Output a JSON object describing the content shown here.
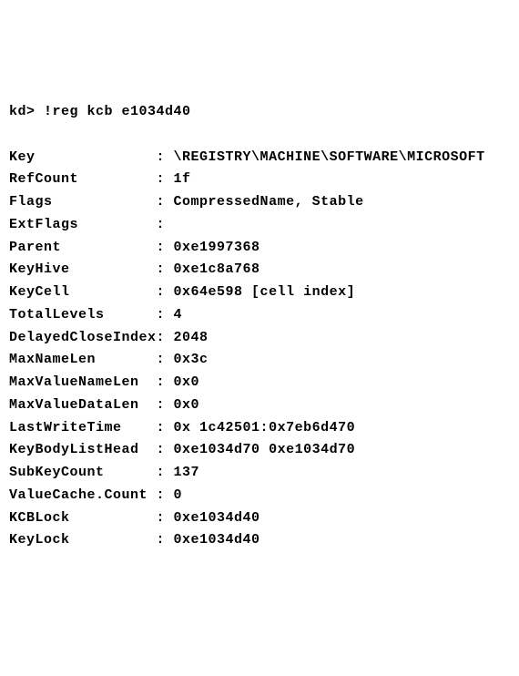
{
  "prompt": "kd> !reg kcb e1034d40",
  "rows": [
    {
      "label": "Key              ",
      "value": "\\REGISTRY\\MACHINE\\SOFTWARE\\MICROSOFT"
    },
    {
      "label": "RefCount         ",
      "value": "1f"
    },
    {
      "label": "Flags            ",
      "value": "CompressedName, Stable"
    },
    {
      "label": "ExtFlags         ",
      "value": ""
    },
    {
      "label": "Parent           ",
      "value": "0xe1997368"
    },
    {
      "label": "KeyHive          ",
      "value": "0xe1c8a768"
    },
    {
      "label": "KeyCell          ",
      "value": "0x64e598 [cell index]"
    },
    {
      "label": "TotalLevels      ",
      "value": "4"
    },
    {
      "label": "DelayedCloseIndex",
      "value": "2048"
    },
    {
      "label": "MaxNameLen       ",
      "value": "0x3c"
    },
    {
      "label": "MaxValueNameLen  ",
      "value": "0x0"
    },
    {
      "label": "MaxValueDataLen  ",
      "value": "0x0"
    },
    {
      "label": "LastWriteTime    ",
      "value": "0x 1c42501:0x7eb6d470"
    },
    {
      "label": "KeyBodyListHead  ",
      "value": "0xe1034d70 0xe1034d70"
    },
    {
      "label": "SubKeyCount      ",
      "value": "137"
    },
    {
      "label": "ValueCache.Count ",
      "value": "0"
    },
    {
      "label": "KCBLock          ",
      "value": "0xe1034d40"
    },
    {
      "label": "KeyLock          ",
      "value": "0xe1034d40"
    }
  ]
}
